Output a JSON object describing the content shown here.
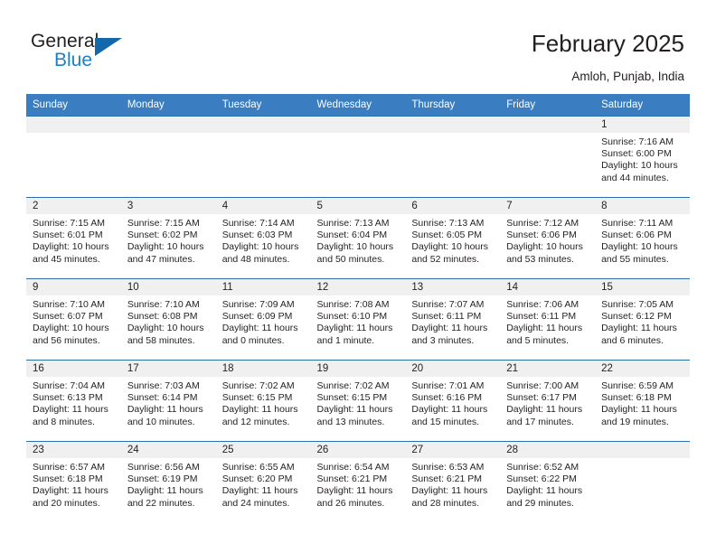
{
  "brand": {
    "name_part1": "General",
    "name_part2": "Blue",
    "triangle_color": "#1268ab",
    "blue_color": "#1f7fc4"
  },
  "header": {
    "title": "February 2025",
    "subtitle": "Amloh, Punjab, India"
  },
  "calendar": {
    "header_bg": "#3a7dc0",
    "daynum_bg": "#f0f0f0",
    "row_border": "#2e6fae",
    "weekdays": [
      "Sunday",
      "Monday",
      "Tuesday",
      "Wednesday",
      "Thursday",
      "Friday",
      "Saturday"
    ],
    "weeks": [
      [
        {
          "day": "",
          "empty": true
        },
        {
          "day": "",
          "empty": true
        },
        {
          "day": "",
          "empty": true
        },
        {
          "day": "",
          "empty": true
        },
        {
          "day": "",
          "empty": true
        },
        {
          "day": "",
          "empty": true
        },
        {
          "day": "1",
          "sunrise": "Sunrise: 7:16 AM",
          "sunset": "Sunset: 6:00 PM",
          "daylight": "Daylight: 10 hours and 44 minutes."
        }
      ],
      [
        {
          "day": "2",
          "sunrise": "Sunrise: 7:15 AM",
          "sunset": "Sunset: 6:01 PM",
          "daylight": "Daylight: 10 hours and 45 minutes."
        },
        {
          "day": "3",
          "sunrise": "Sunrise: 7:15 AM",
          "sunset": "Sunset: 6:02 PM",
          "daylight": "Daylight: 10 hours and 47 minutes."
        },
        {
          "day": "4",
          "sunrise": "Sunrise: 7:14 AM",
          "sunset": "Sunset: 6:03 PM",
          "daylight": "Daylight: 10 hours and 48 minutes."
        },
        {
          "day": "5",
          "sunrise": "Sunrise: 7:13 AM",
          "sunset": "Sunset: 6:04 PM",
          "daylight": "Daylight: 10 hours and 50 minutes."
        },
        {
          "day": "6",
          "sunrise": "Sunrise: 7:13 AM",
          "sunset": "Sunset: 6:05 PM",
          "daylight": "Daylight: 10 hours and 52 minutes."
        },
        {
          "day": "7",
          "sunrise": "Sunrise: 7:12 AM",
          "sunset": "Sunset: 6:06 PM",
          "daylight": "Daylight: 10 hours and 53 minutes."
        },
        {
          "day": "8",
          "sunrise": "Sunrise: 7:11 AM",
          "sunset": "Sunset: 6:06 PM",
          "daylight": "Daylight: 10 hours and 55 minutes."
        }
      ],
      [
        {
          "day": "9",
          "sunrise": "Sunrise: 7:10 AM",
          "sunset": "Sunset: 6:07 PM",
          "daylight": "Daylight: 10 hours and 56 minutes."
        },
        {
          "day": "10",
          "sunrise": "Sunrise: 7:10 AM",
          "sunset": "Sunset: 6:08 PM",
          "daylight": "Daylight: 10 hours and 58 minutes."
        },
        {
          "day": "11",
          "sunrise": "Sunrise: 7:09 AM",
          "sunset": "Sunset: 6:09 PM",
          "daylight": "Daylight: 11 hours and 0 minutes."
        },
        {
          "day": "12",
          "sunrise": "Sunrise: 7:08 AM",
          "sunset": "Sunset: 6:10 PM",
          "daylight": "Daylight: 11 hours and 1 minute."
        },
        {
          "day": "13",
          "sunrise": "Sunrise: 7:07 AM",
          "sunset": "Sunset: 6:11 PM",
          "daylight": "Daylight: 11 hours and 3 minutes."
        },
        {
          "day": "14",
          "sunrise": "Sunrise: 7:06 AM",
          "sunset": "Sunset: 6:11 PM",
          "daylight": "Daylight: 11 hours and 5 minutes."
        },
        {
          "day": "15",
          "sunrise": "Sunrise: 7:05 AM",
          "sunset": "Sunset: 6:12 PM",
          "daylight": "Daylight: 11 hours and 6 minutes."
        }
      ],
      [
        {
          "day": "16",
          "sunrise": "Sunrise: 7:04 AM",
          "sunset": "Sunset: 6:13 PM",
          "daylight": "Daylight: 11 hours and 8 minutes."
        },
        {
          "day": "17",
          "sunrise": "Sunrise: 7:03 AM",
          "sunset": "Sunset: 6:14 PM",
          "daylight": "Daylight: 11 hours and 10 minutes."
        },
        {
          "day": "18",
          "sunrise": "Sunrise: 7:02 AM",
          "sunset": "Sunset: 6:15 PM",
          "daylight": "Daylight: 11 hours and 12 minutes."
        },
        {
          "day": "19",
          "sunrise": "Sunrise: 7:02 AM",
          "sunset": "Sunset: 6:15 PM",
          "daylight": "Daylight: 11 hours and 13 minutes."
        },
        {
          "day": "20",
          "sunrise": "Sunrise: 7:01 AM",
          "sunset": "Sunset: 6:16 PM",
          "daylight": "Daylight: 11 hours and 15 minutes."
        },
        {
          "day": "21",
          "sunrise": "Sunrise: 7:00 AM",
          "sunset": "Sunset: 6:17 PM",
          "daylight": "Daylight: 11 hours and 17 minutes."
        },
        {
          "day": "22",
          "sunrise": "Sunrise: 6:59 AM",
          "sunset": "Sunset: 6:18 PM",
          "daylight": "Daylight: 11 hours and 19 minutes."
        }
      ],
      [
        {
          "day": "23",
          "sunrise": "Sunrise: 6:57 AM",
          "sunset": "Sunset: 6:18 PM",
          "daylight": "Daylight: 11 hours and 20 minutes."
        },
        {
          "day": "24",
          "sunrise": "Sunrise: 6:56 AM",
          "sunset": "Sunset: 6:19 PM",
          "daylight": "Daylight: 11 hours and 22 minutes."
        },
        {
          "day": "25",
          "sunrise": "Sunrise: 6:55 AM",
          "sunset": "Sunset: 6:20 PM",
          "daylight": "Daylight: 11 hours and 24 minutes."
        },
        {
          "day": "26",
          "sunrise": "Sunrise: 6:54 AM",
          "sunset": "Sunset: 6:21 PM",
          "daylight": "Daylight: 11 hours and 26 minutes."
        },
        {
          "day": "27",
          "sunrise": "Sunrise: 6:53 AM",
          "sunset": "Sunset: 6:21 PM",
          "daylight": "Daylight: 11 hours and 28 minutes."
        },
        {
          "day": "28",
          "sunrise": "Sunrise: 6:52 AM",
          "sunset": "Sunset: 6:22 PM",
          "daylight": "Daylight: 11 hours and 29 minutes."
        },
        {
          "day": "",
          "empty": true
        }
      ]
    ]
  }
}
